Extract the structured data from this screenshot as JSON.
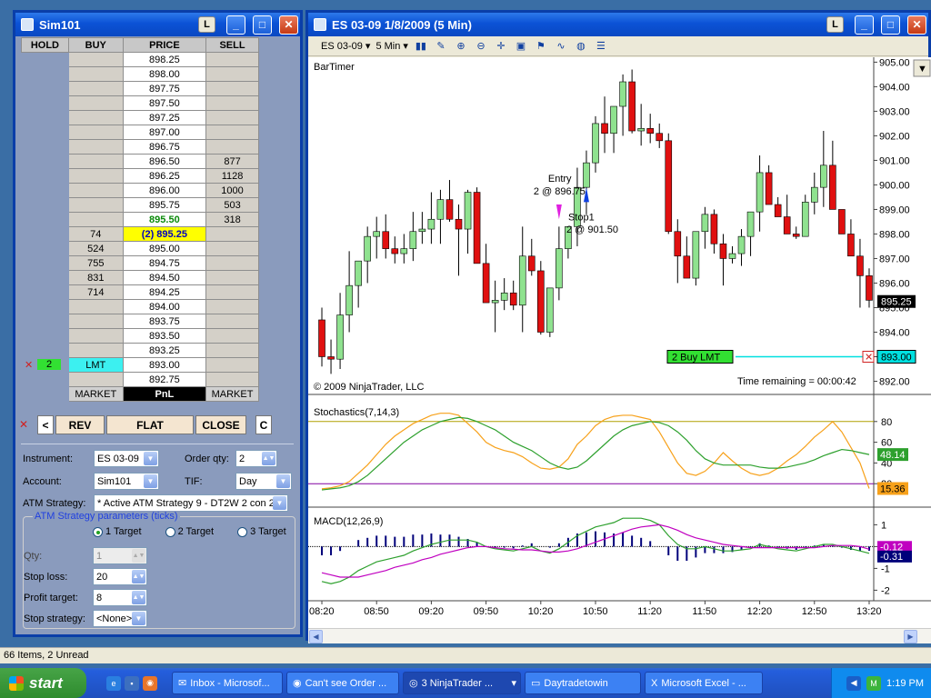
{
  "dom": {
    "title": "Sim101",
    "lock_label": "L",
    "headers": [
      "HOLD",
      "BUY",
      "PRICE",
      "SELL"
    ],
    "rows": [
      {
        "buy": "",
        "price": "898.25",
        "sell": ""
      },
      {
        "buy": "",
        "price": "898.00",
        "sell": ""
      },
      {
        "buy": "",
        "price": "897.75",
        "sell": ""
      },
      {
        "buy": "",
        "price": "897.50",
        "sell": ""
      },
      {
        "buy": "",
        "price": "897.25",
        "sell": ""
      },
      {
        "buy": "",
        "price": "897.00",
        "sell": ""
      },
      {
        "buy": "",
        "price": "896.75",
        "sell": ""
      },
      {
        "buy": "",
        "price": "896.50",
        "sell": "877"
      },
      {
        "buy": "",
        "price": "896.25",
        "sell": "1128"
      },
      {
        "buy": "",
        "price": "896.00",
        "sell": "1000"
      },
      {
        "buy": "",
        "price": "895.75",
        "sell": "503"
      },
      {
        "buy": "",
        "price": "895.50",
        "sell": "318"
      },
      {
        "buy": "74",
        "price": "(2) 895.25",
        "sell": ""
      },
      {
        "buy": "524",
        "price": "895.00",
        "sell": ""
      },
      {
        "buy": "755",
        "price": "894.75",
        "sell": ""
      },
      {
        "buy": "831",
        "price": "894.50",
        "sell": ""
      },
      {
        "buy": "714",
        "price": "894.25",
        "sell": ""
      },
      {
        "buy": "",
        "price": "894.00",
        "sell": ""
      },
      {
        "buy": "",
        "price": "893.75",
        "sell": ""
      },
      {
        "buy": "",
        "price": "893.50",
        "sell": ""
      },
      {
        "buy": "",
        "price": "893.25",
        "sell": ""
      },
      {
        "buy": "LMT",
        "price": "893.00",
        "sell": ""
      },
      {
        "buy": "",
        "price": "892.75",
        "sell": ""
      }
    ],
    "order_qty_badge": "2",
    "footer": [
      "MARKET",
      "PnL",
      "MARKET"
    ],
    "buttons": {
      "left": "<",
      "rev": "REV",
      "flat": "FLAT",
      "close": "CLOSE",
      "c": "C"
    },
    "instrument_label": "Instrument:",
    "instrument": "ES 03-09",
    "order_qty_label": "Order qty:",
    "order_qty": "2",
    "account_label": "Account:",
    "account": "Sim101",
    "tif_label": "TIF:",
    "tif": "Day",
    "atm_label": "ATM Strategy:",
    "atm": "* Active ATM Strategy 9 - DT2W 2 con 2",
    "params_title": "ATM Strategy parameters (ticks)",
    "targets": [
      "1 Target",
      "2 Target",
      "3 Target"
    ],
    "qty_label": "Qty:",
    "qty": "1",
    "stop_loss_label": "Stop loss:",
    "stop_loss": "20",
    "profit_target_label": "Profit target:",
    "profit_target": "8",
    "stop_strategy_label": "Stop strategy:",
    "stop_strategy": "<None>"
  },
  "chart": {
    "title": "ES 03-09  1/8/2009 (5 Min)",
    "lock_label": "L",
    "toolbar": {
      "instrument": "ES 03-09",
      "interval": "5 Min"
    },
    "bartimer": "BarTimer",
    "copyright": "© 2009 NinjaTrader, LLC",
    "time_remaining": "Time remaining = 00:00:42",
    "entry_label": "Entry",
    "entry_value": "2 @ 896.75",
    "stop_label": "Stop1",
    "stop_value": "2 @ 901.50",
    "buy_lmt": "2  Buy LMT",
    "buy_lmt_price": "893.00",
    "last_price": "895.25",
    "stoch_label": "Stochastics(7,14,3)",
    "stoch_values": [
      "48.14",
      "15.36"
    ],
    "macd_label": "MACD(12,26,9)",
    "macd_values": [
      "-0.12",
      "-0.31"
    ],
    "price_ticks": [
      "905.00",
      "904.00",
      "903.00",
      "902.00",
      "901.00",
      "900.00",
      "899.00",
      "898.00",
      "897.00",
      "896.00",
      "895.00",
      "894.00",
      "893.00",
      "892.00"
    ],
    "stoch_ticks": [
      "80",
      "60",
      "40",
      "20"
    ],
    "macd_ticks": [
      "1",
      "0",
      "-1",
      "-2"
    ],
    "time_ticks": [
      "08:20",
      "08:50",
      "09:20",
      "09:50",
      "10:20",
      "10:50",
      "11:20",
      "11:50",
      "12:20",
      "12:50",
      "13:20"
    ],
    "colors": {
      "up": "#8fe28f",
      "down": "#e01010",
      "stoch_k": "#f7a11a",
      "stoch_d": "#2da02d",
      "macd_sig": "#c000c0",
      "macd_avg": "#2da02d",
      "macd_hist": "#00007a"
    }
  },
  "chart_data": {
    "type": "candlestick",
    "title": "ES 03-09  1/8/2009 (5 Min)",
    "x": [
      "08:20",
      "08:25",
      "08:30",
      "08:35",
      "08:40",
      "08:45",
      "08:50",
      "08:55",
      "09:00",
      "09:05",
      "09:10",
      "09:15",
      "09:20",
      "09:25",
      "09:30",
      "09:35",
      "09:40",
      "09:45",
      "09:50",
      "09:55",
      "10:00",
      "10:05",
      "10:10",
      "10:15",
      "10:20",
      "10:25",
      "10:30",
      "10:35",
      "10:40",
      "10:45",
      "10:50",
      "10:55",
      "11:00",
      "11:05",
      "11:10",
      "11:15",
      "11:20",
      "11:25",
      "11:30",
      "11:35",
      "11:40",
      "11:45",
      "11:50",
      "11:55",
      "12:00",
      "12:05",
      "12:10",
      "12:15",
      "12:20",
      "12:25",
      "12:30",
      "12:35",
      "12:40",
      "12:45",
      "12:50",
      "12:55",
      "13:00",
      "13:05",
      "13:10",
      "13:15",
      "13:20"
    ],
    "candles": [
      [
        894.5,
        892.6,
        895.0,
        893.0
      ],
      [
        893.0,
        892.3,
        893.7,
        892.9
      ],
      [
        892.9,
        892.5,
        895.6,
        894.7
      ],
      [
        894.7,
        894.0,
        897.3,
        895.9
      ],
      [
        895.9,
        895.0,
        896.9,
        896.9
      ],
      [
        896.9,
        896.0,
        898.3,
        897.9
      ],
      [
        897.9,
        897.0,
        898.7,
        898.1
      ],
      [
        898.1,
        897.0,
        898.8,
        897.4
      ],
      [
        897.4,
        896.8,
        897.9,
        897.2
      ],
      [
        897.2,
        896.8,
        898.0,
        897.4
      ],
      [
        897.4,
        896.9,
        898.9,
        898.1
      ],
      [
        898.1,
        897.6,
        898.9,
        898.2
      ],
      [
        898.2,
        897.6,
        899.7,
        898.6
      ],
      [
        898.6,
        897.6,
        899.8,
        899.4
      ],
      [
        899.4,
        898.5,
        900.2,
        898.6
      ],
      [
        898.6,
        896.3,
        899.2,
        898.2
      ],
      [
        898.2,
        897.2,
        899.8,
        899.7
      ],
      [
        899.7,
        897.0,
        899.9,
        896.8
      ],
      [
        896.8,
        895.3,
        897.6,
        895.2
      ],
      [
        895.2,
        894.0,
        896.1,
        895.3
      ],
      [
        895.3,
        894.9,
        896.2,
        895.6
      ],
      [
        895.6,
        894.9,
        896.1,
        895.1
      ],
      [
        895.1,
        894.0,
        898.3,
        897.1
      ],
      [
        897.1,
        896.3,
        897.8,
        896.5
      ],
      [
        896.5,
        893.9,
        896.9,
        894.0
      ],
      [
        894.0,
        893.8,
        895.6,
        895.8
      ],
      [
        895.8,
        895.3,
        898.3,
        897.4
      ],
      [
        897.4,
        897.0,
        898.3,
        898.3
      ],
      [
        898.3,
        897.5,
        900.7,
        899.9
      ],
      [
        899.9,
        898.8,
        901.4,
        900.9
      ],
      [
        900.9,
        900.5,
        902.8,
        902.5
      ],
      [
        902.5,
        901.3,
        903.6,
        902.1
      ],
      [
        902.1,
        901.3,
        903.1,
        903.2
      ],
      [
        903.2,
        902.0,
        904.5,
        904.2
      ],
      [
        904.2,
        902.1,
        904.7,
        902.2
      ],
      [
        902.2,
        901.6,
        903.3,
        902.3
      ],
      [
        902.3,
        901.7,
        902.9,
        902.1
      ],
      [
        902.1,
        901.5,
        902.5,
        901.8
      ],
      [
        901.8,
        898.0,
        902.1,
        898.1
      ],
      [
        898.1,
        896.0,
        898.6,
        897.1
      ],
      [
        897.1,
        896.4,
        897.9,
        896.2
      ],
      [
        896.2,
        895.9,
        898.1,
        898.1
      ],
      [
        898.1,
        897.4,
        899.1,
        898.8
      ],
      [
        898.8,
        897.2,
        899.0,
        897.6
      ],
      [
        897.6,
        895.9,
        898.0,
        897.0
      ],
      [
        897.0,
        896.8,
        897.5,
        897.2
      ],
      [
        897.2,
        896.7,
        898.2,
        897.9
      ],
      [
        897.9,
        897.1,
        898.9,
        898.9
      ],
      [
        898.9,
        898.1,
        901.2,
        900.5
      ],
      [
        900.5,
        899.3,
        900.8,
        899.2
      ],
      [
        899.2,
        898.9,
        899.5,
        898.7
      ],
      [
        898.7,
        898.0,
        899.6,
        898.0
      ],
      [
        898.0,
        897.8,
        898.3,
        897.9
      ],
      [
        897.9,
        897.9,
        899.6,
        899.3
      ],
      [
        899.3,
        898.8,
        900.5,
        899.9
      ],
      [
        899.9,
        899.1,
        902.2,
        900.8
      ],
      [
        900.8,
        899.6,
        901.8,
        899.0
      ],
      [
        899.0,
        898.0,
        899.0,
        898.0
      ],
      [
        898.0,
        897.2,
        898.6,
        897.1
      ],
      [
        897.1,
        895.0,
        897.8,
        896.3
      ],
      [
        896.3,
        895.0,
        896.6,
        895.3
      ]
    ],
    "ylim": [
      891.5,
      905.2
    ],
    "stochastics_k": [
      15,
      16,
      18,
      22,
      30,
      38,
      48,
      58,
      66,
      72,
      78,
      82,
      86,
      88,
      88,
      86,
      78,
      70,
      60,
      55,
      52,
      50,
      46,
      40,
      35,
      34,
      36,
      44,
      58,
      66,
      76,
      82,
      85,
      86,
      86,
      84,
      82,
      70,
      55,
      40,
      30,
      28,
      32,
      40,
      50,
      42,
      35,
      30,
      28,
      30,
      35,
      42,
      48,
      56,
      65,
      72,
      80,
      70,
      55,
      40,
      15.36
    ],
    "stochastics_d": [
      14,
      15,
      16,
      18,
      22,
      28,
      36,
      44,
      52,
      60,
      66,
      72,
      76,
      80,
      82,
      84,
      83,
      80,
      76,
      72,
      66,
      60,
      56,
      52,
      46,
      40,
      36,
      34,
      36,
      42,
      50,
      58,
      66,
      72,
      76,
      78,
      80,
      79,
      76,
      70,
      62,
      52,
      44,
      40,
      38,
      38,
      38,
      38,
      36,
      35,
      35,
      36,
      38,
      40,
      43,
      47,
      50,
      53,
      52,
      50,
      48.14
    ],
    "macd": [
      -1.6,
      -1.7,
      -1.6,
      -1.4,
      -1.1,
      -0.9,
      -0.7,
      -0.6,
      -0.5,
      -0.4,
      -0.2,
      -0.05,
      0.1,
      0.2,
      0.3,
      0.3,
      0.3,
      0.2,
      0.0,
      -0.1,
      -0.15,
      -0.2,
      -0.1,
      0.0,
      -0.2,
      -0.3,
      -0.1,
      0.2,
      0.5,
      0.7,
      0.9,
      1.0,
      1.1,
      1.3,
      1.3,
      1.3,
      1.2,
      1.0,
      0.5,
      0.1,
      -0.1,
      -0.1,
      0.0,
      -0.1,
      -0.2,
      -0.2,
      -0.15,
      -0.1,
      0.1,
      0.0,
      -0.1,
      -0.15,
      -0.2,
      -0.1,
      0.0,
      0.1,
      0.1,
      0.0,
      -0.1,
      -0.2,
      -0.31
    ],
    "macd_signal": [
      -1.2,
      -1.3,
      -1.4,
      -1.4,
      -1.4,
      -1.3,
      -1.2,
      -1.1,
      -0.95,
      -0.85,
      -0.75,
      -0.6,
      -0.5,
      -0.35,
      -0.25,
      -0.15,
      -0.05,
      0.0,
      0.0,
      -0.05,
      -0.1,
      -0.12,
      -0.15,
      -0.15,
      -0.2,
      -0.25,
      -0.25,
      -0.2,
      -0.1,
      0.05,
      0.2,
      0.35,
      0.5,
      0.65,
      0.8,
      0.9,
      0.95,
      1.0,
      0.9,
      0.75,
      0.55,
      0.4,
      0.3,
      0.2,
      0.1,
      0.05,
      0.0,
      -0.05,
      -0.05,
      -0.05,
      -0.05,
      -0.05,
      -0.05,
      -0.05,
      -0.05,
      0.0,
      0.05,
      0.05,
      0.05,
      0.0,
      -0.12
    ],
    "time_ticks": [
      "08:20",
      "08:50",
      "09:20",
      "09:50",
      "10:20",
      "10:50",
      "11:20",
      "11:50",
      "12:20",
      "12:50",
      "13:20"
    ]
  },
  "taskbar": {
    "start": "start",
    "tasks": [
      "Inbox - Microsof...",
      "Can't see Order ...",
      "3 NinjaTrader ...",
      "Daytradetowin",
      "Microsoft Excel - ..."
    ],
    "clock": "1:19 PM"
  },
  "status": {
    "items": "66 Items, 2 Unread"
  }
}
